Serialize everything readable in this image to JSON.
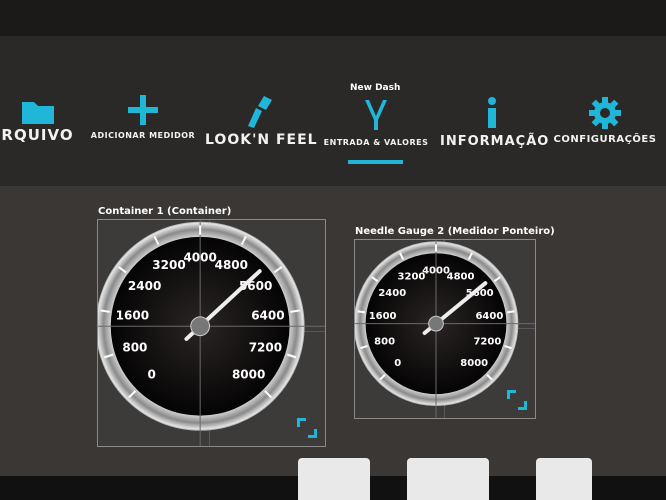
{
  "app": {
    "subtitle": "New Dash"
  },
  "nav": [
    {
      "label": "RQUIVO",
      "icon": "folder-icon"
    },
    {
      "label": "ADICIONAR MEDIDOR",
      "icon": "plus-icon"
    },
    {
      "label": "LOOK'N FEEL",
      "icon": "brush-icon"
    },
    {
      "label": "ENTRADA & VALORES",
      "icon": "connector-icon"
    },
    {
      "label": "INFORMAÇÃO",
      "icon": "info-icon"
    },
    {
      "label": "CONFIGURAÇÕES",
      "icon": "gear-icon"
    }
  ],
  "active_tab": "ENTRADA & VALORES",
  "accent_color": "#1fb6d8",
  "gauges": [
    {
      "title": "Container 1  (Container)",
      "ticks": [
        "0",
        "800",
        "1600",
        "2400",
        "3200",
        "4000",
        "4800",
        "5600",
        "6400",
        "7200",
        "8000"
      ],
      "value": 5400
    },
    {
      "title": "Needle Gauge 2  (Medidor Ponteiro)",
      "ticks": [
        "0",
        "800",
        "1600",
        "2400",
        "3200",
        "4000",
        "4800",
        "5600",
        "6400",
        "7200",
        "8000"
      ],
      "value": 5500
    }
  ]
}
